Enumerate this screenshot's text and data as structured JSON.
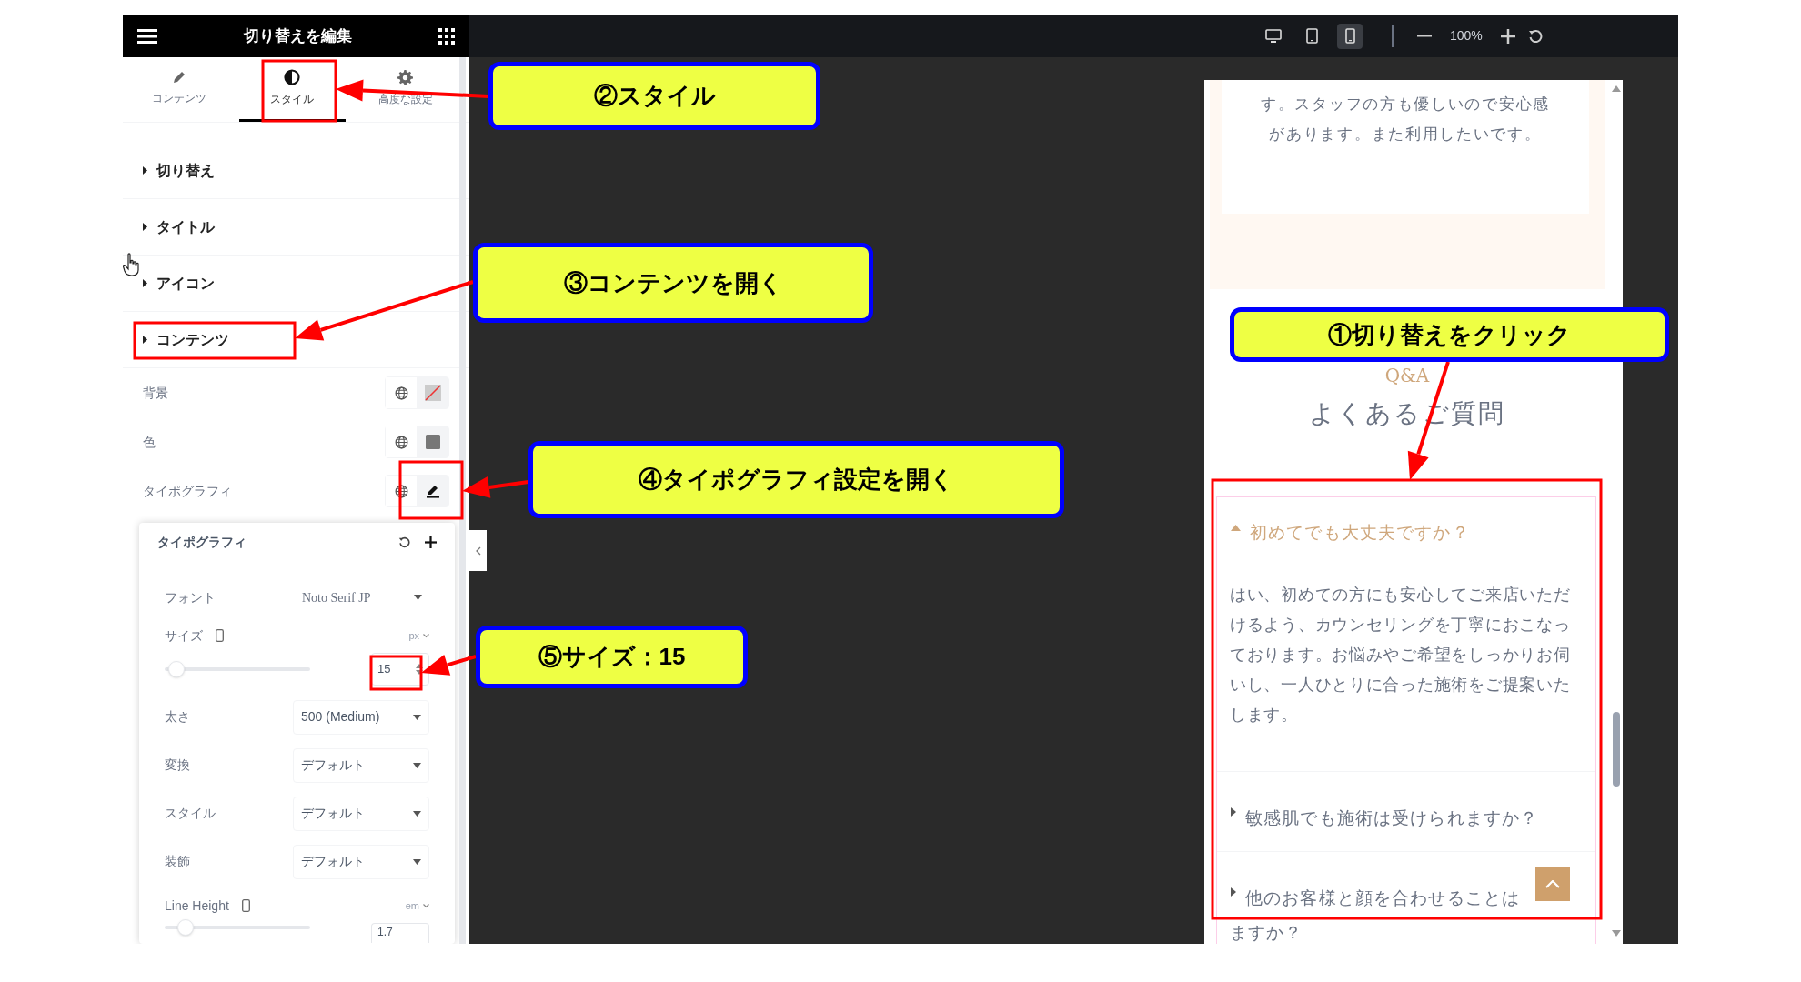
{
  "editor_panel": {
    "title": "切り替えを編集",
    "tabs": [
      {
        "label": "コンテンツ",
        "kind": "pencil",
        "selected": false
      },
      {
        "label": "スタイル",
        "kind": "contrast",
        "selected": true
      },
      {
        "label": "高度な設定",
        "kind": "gear",
        "selected": false
      }
    ],
    "sections": [
      "切り替え",
      "タイトル",
      "アイコン",
      "コンテンツ"
    ],
    "controls": [
      {
        "label": "背景",
        "kind": "background"
      },
      {
        "label": "色",
        "kind": "color"
      },
      {
        "label": "タイポグラフィ",
        "kind": "typography"
      }
    ],
    "typography_popover": {
      "title": "タイポグラフィ",
      "font": {
        "label": "フォント",
        "value": "Noto Serif JP"
      },
      "size": {
        "label": "サイズ",
        "unit": "px",
        "value": "15",
        "level": 0.03
      },
      "selects": [
        {
          "label": "太さ",
          "value": "500 (Medium)"
        },
        {
          "label": "変換",
          "value": "デフォルト"
        },
        {
          "label": "スタイル",
          "value": "デフォルト"
        },
        {
          "label": "装飾",
          "value": "デフォルト"
        }
      ],
      "line_height": {
        "label": "Line Height",
        "unit": "em",
        "value": "1.7",
        "level": 0.1
      }
    }
  },
  "toolbar": {
    "devices": [
      {
        "kind": "desktop",
        "selected": false
      },
      {
        "kind": "tablet",
        "selected": false
      },
      {
        "kind": "mobile",
        "selected": true
      }
    ],
    "zoom": "100%"
  },
  "preview": {
    "testimonial_lines": [
      "す。スタッフの方も優しいので安心感",
      "があります。また利用したいです。"
    ],
    "eyebrow": "Q&A",
    "heading": "よくあるご質問",
    "faq": [
      {
        "question": "初めてでも大丈夫ですか？",
        "expanded": true,
        "answer": "はい、初めての方にも安心してご来店いただけるよう、カウンセリングを丁寧におこなっております。お悩みやご希望をしっかりお伺いし、一人ひとりに合った施術をご提案いたします。"
      },
      {
        "question": "敏感肌でも施術は受けられますか？",
        "expanded": false
      },
      {
        "question": "他のお客様と顔を合わせることは",
        "question_continued": "ますか？",
        "expanded": false
      }
    ]
  },
  "annotations": [
    "①切り替えをクリック",
    "②スタイル",
    "③コンテンツを開く",
    "④タイポグラフィ設定を開く",
    "⑤サイズ：15"
  ]
}
